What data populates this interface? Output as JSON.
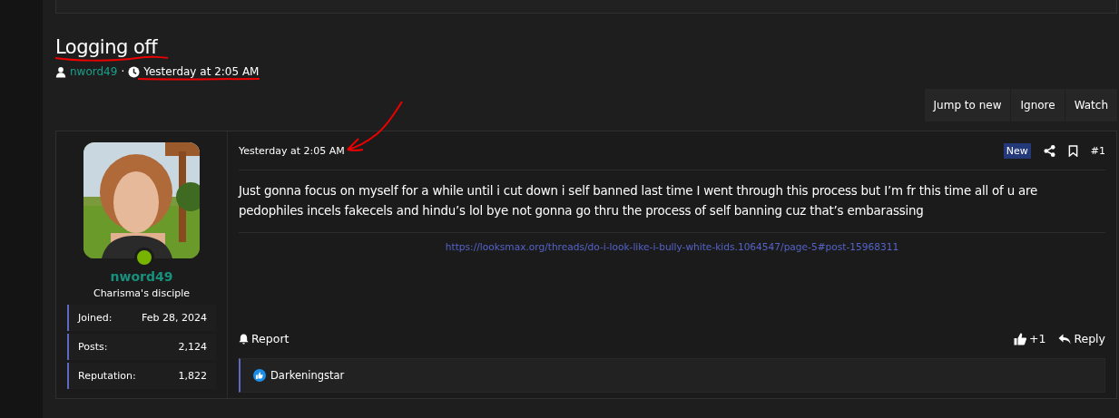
{
  "thread": {
    "title": "Logging off",
    "author": "nword49",
    "separator": "·",
    "date": "Yesterday at 2:05 AM"
  },
  "thread_actions": [
    "Jump to new",
    "Ignore",
    "Watch"
  ],
  "post": {
    "user": {
      "name": "nword49",
      "online": true,
      "title": "Charisma's disciple",
      "stats": [
        {
          "label": "Joined:",
          "value": "Feb 28, 2024"
        },
        {
          "label": "Posts:",
          "value": "2,124"
        },
        {
          "label": "Reputation:",
          "value": "1,822"
        }
      ]
    },
    "date": "Yesterday at 2:05 AM",
    "badge": "New",
    "number": "#1",
    "body": "Just gonna focus on myself for a while until i cut down i self banned last time I went through this process but I’m fr this time all of u are pedophiles incels fakecels and hindu’s lol bye not gonna go thru the process of self banning cuz that’s embarassing",
    "link": "https://looksmax.org/threads/do-i-look-like-i-bully-white-kids.1064547/page-5#post-15968311",
    "report": "Report",
    "likes": "+1",
    "reply": "Reply",
    "reactions": [
      "Darkeningstar"
    ]
  }
}
